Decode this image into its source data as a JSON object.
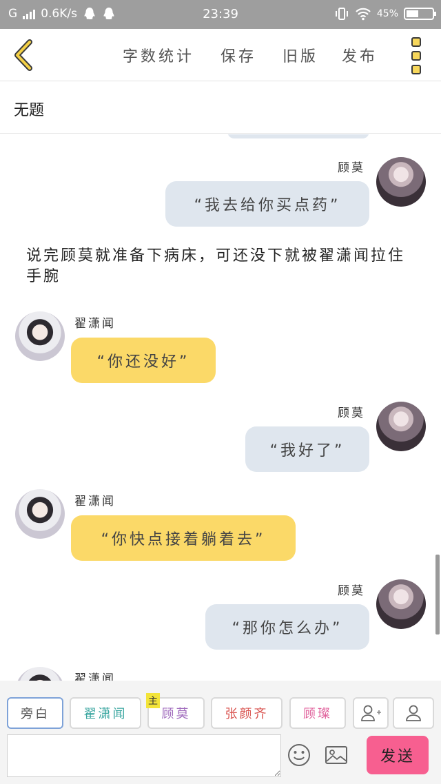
{
  "status_bar": {
    "carrier": "G",
    "speed": "0.6K/s",
    "time": "23:39",
    "battery": "45%"
  },
  "toolbar": {
    "word_count": "字数统计",
    "save": "保存",
    "old_version": "旧版",
    "publish": "发布"
  },
  "title": "无题",
  "messages": [
    {
      "speaker": "顾莫",
      "side": "right",
      "text": "“我去给你买点药”"
    },
    {
      "narration": "说完顾莫就准备下病床，可还没下就被翟潇闻拉住手腕"
    },
    {
      "speaker": "翟潇闻",
      "side": "left",
      "text": "“你还没好”"
    },
    {
      "speaker": "顾莫",
      "side": "right",
      "text": "“我好了”"
    },
    {
      "speaker": "翟潇闻",
      "side": "left",
      "text": "“你快点接着躺着去”"
    },
    {
      "speaker": "顾莫",
      "side": "right",
      "text": "“那你怎么办”"
    },
    {
      "speaker": "翟潇闻",
      "side": "left",
      "text": ""
    }
  ],
  "roles": {
    "narrator": "旁白",
    "role1": "翟潇闻",
    "role2": "顾莫",
    "host_tag": "主",
    "role3": "张颜齐",
    "role4": "顾璨"
  },
  "colors": {
    "right_bubble": "#dfe6ee",
    "left_bubble": "#fbd968",
    "send_button": "#f75f90",
    "role1_text": "#3aa6a0",
    "role2_text": "#a06bbd",
    "role3_text": "#d9534f",
    "role4_text": "#e0609b"
  },
  "input": {
    "placeholder": "",
    "send": "发送"
  }
}
